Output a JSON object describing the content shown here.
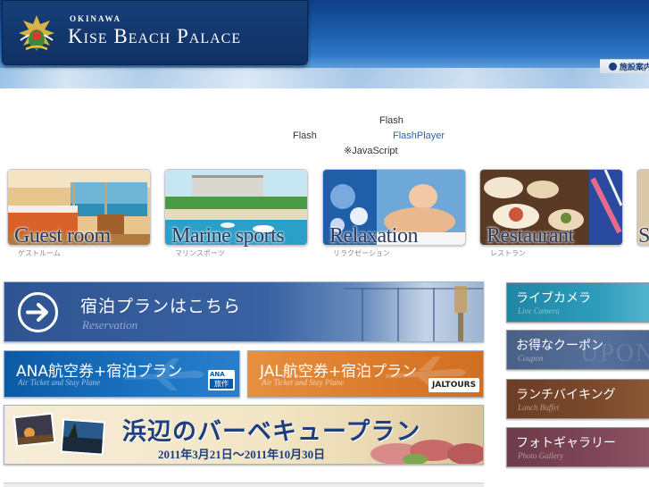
{
  "header": {
    "logo_small": "OKINAWA",
    "logo_main": "Kise Beach Palace",
    "facility_link": "施設案内"
  },
  "notice": {
    "line1": "Flash",
    "line2_a": "Flash",
    "line2_b": "FlashPlayer",
    "line3": "※JavaScript"
  },
  "categories": [
    {
      "title": "Guest room",
      "sub": "ゲストルーム"
    },
    {
      "title": "Marine sports",
      "sub": "マリンスポーツ"
    },
    {
      "title": "Relaxation",
      "sub": "リラクゼーション"
    },
    {
      "title": "Restaurant",
      "sub": "レストラン"
    },
    {
      "title": "S",
      "sub": ""
    }
  ],
  "banners": {
    "reservation_title": "宿泊プランはこちら",
    "reservation_sub": "Reservation",
    "ana_title": "ANA航空券+宿泊プラン",
    "ana_sub": "Air Ticket and Stay Plane",
    "ana_badge_top": "ANA",
    "ana_badge_bottom": "旅作",
    "jal_title": "JAL航空券+宿泊プラン",
    "jal_sub": "Air Ticket and Stay Plane",
    "jal_badge": "JALTOURS",
    "bbq_title": "浜辺のバーベキュープラン",
    "bbq_dates": "2011年3月21日〜2011年10月30日"
  },
  "side_nav": [
    {
      "title": "ライブカメラ",
      "sub": "Live Camera"
    },
    {
      "title": "お得なクーポン",
      "sub": "Coupon",
      "watermark": "UPON"
    },
    {
      "title": "ランチバイキング",
      "sub": "Lunch Buffet"
    },
    {
      "title": "フォトギャラリー",
      "sub": "Photo Gallery"
    }
  ],
  "colors": {
    "header_blue": "#1b5cab",
    "title_navy": "#2b3a5e",
    "link_blue": "#2a62b8"
  }
}
